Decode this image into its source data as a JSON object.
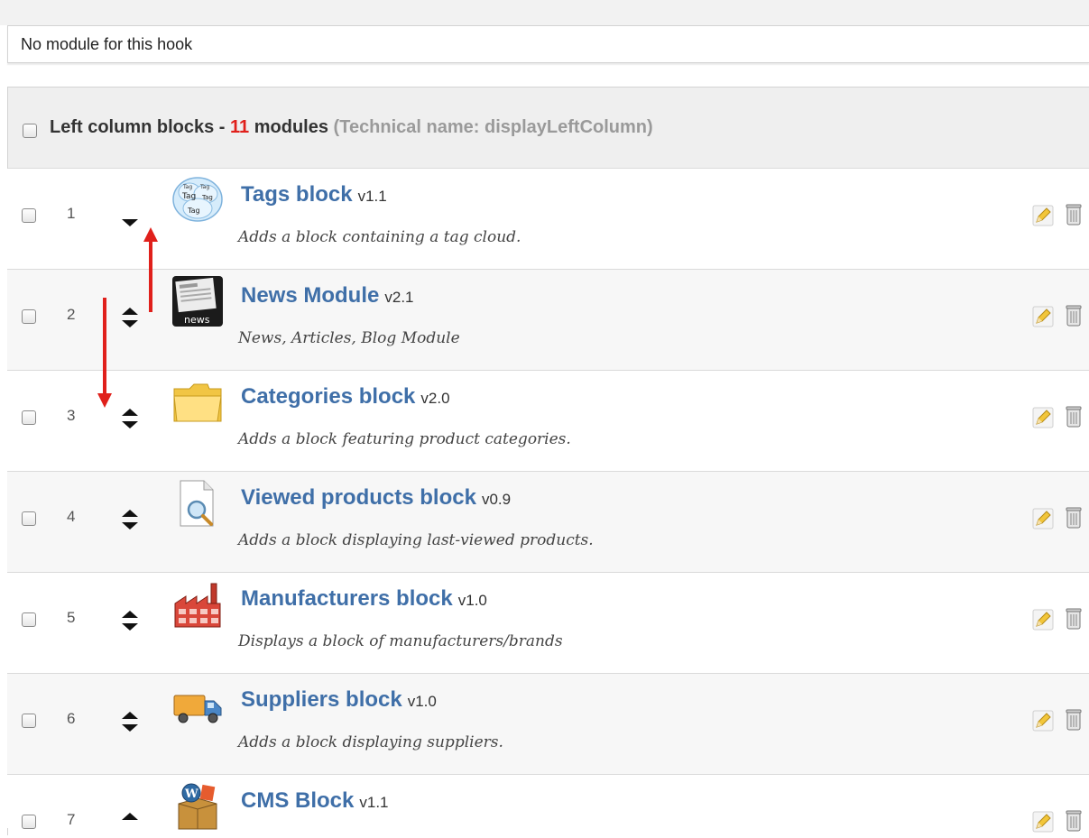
{
  "no_hook_message": "No module for this hook",
  "hook": {
    "title_prefix": "Left column blocks - ",
    "count": "11",
    "count_suffix": " modules",
    "technical_name": "(Technical name: displayLeftColumn)"
  },
  "modules": [
    {
      "position": "1",
      "name": "Tags block",
      "version": "v1.1",
      "description": "Adds a block containing a tag cloud.",
      "icon": "tag-cloud-icon",
      "can_move_up": false,
      "can_move_down": true
    },
    {
      "position": "2",
      "name": "News Module",
      "version": "v2.1",
      "description": "News, Articles, Blog Module",
      "icon": "news-icon",
      "can_move_up": true,
      "can_move_down": true
    },
    {
      "position": "3",
      "name": "Categories block",
      "version": "v2.0",
      "description": "Adds a block featuring product categories.",
      "icon": "folder-icon",
      "can_move_up": true,
      "can_move_down": true
    },
    {
      "position": "4",
      "name": "Viewed products block",
      "version": "v0.9",
      "description": "Adds a block displaying last-viewed products.",
      "icon": "magnifier-document-icon",
      "can_move_up": true,
      "can_move_down": true
    },
    {
      "position": "5",
      "name": "Manufacturers block",
      "version": "v1.0",
      "description": "Displays a block of manufacturers/brands",
      "icon": "factory-icon",
      "can_move_up": true,
      "can_move_down": true
    },
    {
      "position": "6",
      "name": "Suppliers block",
      "version": "v1.0",
      "description": "Adds a block displaying suppliers.",
      "icon": "truck-icon",
      "can_move_up": true,
      "can_move_down": true
    },
    {
      "position": "7",
      "name": "CMS Block",
      "version": "v1.1",
      "description": "",
      "icon": "cms-box-icon",
      "can_move_up": true,
      "can_move_down": true
    }
  ],
  "colors": {
    "module_link": "#3f6fa8",
    "count_highlight": "#e0201b",
    "annotation_arrow": "#e0201b"
  }
}
